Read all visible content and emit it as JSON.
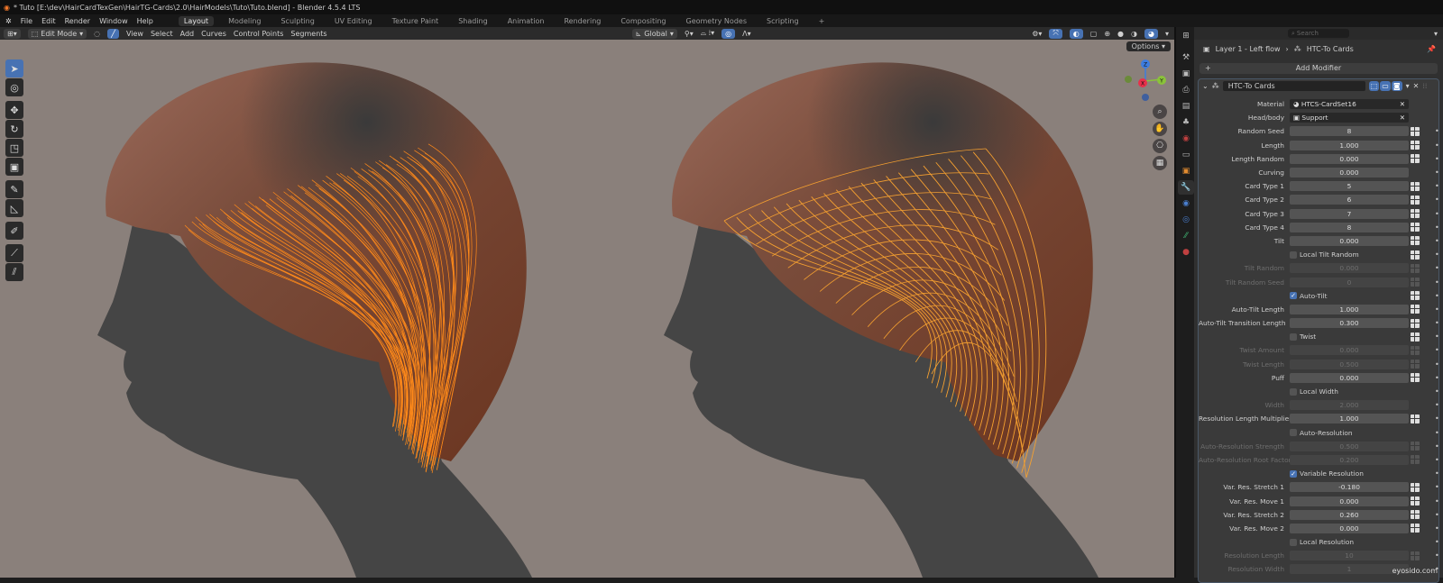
{
  "title": "* Tuto [E:\\dev\\HairCardTexGen\\HairTG-Cards\\2.0\\HairModels\\Tuto\\Tuto.blend] - Blender 4.5.4 LTS",
  "menu": [
    "File",
    "Edit",
    "Render",
    "Window",
    "Help"
  ],
  "workspaces": [
    "Layout",
    "Modeling",
    "Sculpting",
    "UV Editing",
    "Texture Paint",
    "Shading",
    "Animation",
    "Rendering",
    "Compositing",
    "Geometry Nodes",
    "Scripting",
    "+"
  ],
  "viewport_header": {
    "mode": "Edit Mode",
    "menus": [
      "View",
      "Select",
      "Add",
      "Curves",
      "Control Points",
      "Segments"
    ],
    "orientation": "Global",
    "options": "Options"
  },
  "gizmo": {
    "x": "X",
    "y": "Y",
    "z": "Z"
  },
  "props": {
    "search_placeholder": "Search",
    "breadcrumb": [
      "Layer 1 - Left flow",
      "HTC-To Cards"
    ],
    "add_modifier": "Add Modifier",
    "modifier_name": "HTC-To Cards",
    "rows": [
      {
        "label": "Material",
        "value": "HTCS-CardSet16",
        "type": "obj"
      },
      {
        "label": "Head/body",
        "value": "Support",
        "type": "obj"
      },
      {
        "label": "Random Seed",
        "value": "8",
        "deco": true
      },
      {
        "label": "Length",
        "value": "1.000",
        "deco": true
      },
      {
        "label": "Length Random",
        "value": "0.000",
        "deco": true
      },
      {
        "label": "Curving",
        "value": "0.000"
      },
      {
        "label": "Card Type 1",
        "value": "5",
        "deco": true
      },
      {
        "label": "Card Type 2",
        "value": "6",
        "deco": true
      },
      {
        "label": "Card Type 3",
        "value": "7",
        "deco": true
      },
      {
        "label": "Card Type 4",
        "value": "8",
        "deco": true
      },
      {
        "label": "Tilt",
        "value": "0.000",
        "deco": true
      },
      {
        "label": "Local Tilt Random",
        "type": "check",
        "checked": false,
        "deco": true
      },
      {
        "label": "Tilt Random",
        "value": "0.000",
        "disabled": true,
        "deco": true
      },
      {
        "label": "Tilt Random Seed",
        "value": "0",
        "disabled": true,
        "deco": true
      },
      {
        "label": "Auto-Tilt",
        "type": "check",
        "checked": true,
        "deco": true
      },
      {
        "label": "Auto-Tilt Length",
        "value": "1.000",
        "deco": true
      },
      {
        "label": "Auto-Tilt Transition Length",
        "value": "0.300",
        "deco": true
      },
      {
        "label": "Twist",
        "type": "check",
        "checked": false,
        "deco": true
      },
      {
        "label": "Twist Amount",
        "value": "0.000",
        "disabled": true,
        "deco": true
      },
      {
        "label": "Twist Length",
        "value": "0.500",
        "disabled": true,
        "deco": true
      },
      {
        "label": "Puff",
        "value": "0.000",
        "deco": true
      },
      {
        "label": "Local Width",
        "type": "check",
        "checked": false
      },
      {
        "label": "Width",
        "value": "2.000",
        "disabled": true
      },
      {
        "label": "Resolution Length Multiplier",
        "value": "1.000",
        "deco": true
      },
      {
        "label": "Auto-Resolution",
        "type": "check",
        "checked": false
      },
      {
        "label": "Auto-Resolution Strength",
        "value": "0.500",
        "disabled": true,
        "deco": true
      },
      {
        "label": "Auto-Resolution Root Factor",
        "value": "0.200",
        "disabled": true,
        "deco": true
      },
      {
        "label": "Variable Resolution",
        "type": "check",
        "checked": true
      },
      {
        "label": "Var. Res. Stretch 1",
        "value": "-0.180",
        "deco": true
      },
      {
        "label": "Var. Res. Move 1",
        "value": "0.000",
        "deco": true
      },
      {
        "label": "Var. Res. Stretch 2",
        "value": "0.260",
        "deco": true
      },
      {
        "label": "Var. Res. Move 2",
        "value": "0.000",
        "deco": true
      },
      {
        "label": "Local Resolution",
        "type": "check",
        "checked": false
      },
      {
        "label": "Resolution Length",
        "value": "10",
        "disabled": true,
        "deco": true
      },
      {
        "label": "Resolution Width",
        "value": "1",
        "disabled": true
      }
    ]
  },
  "watermark": "eyosido.com",
  "colors": {
    "accent": "#4772b3",
    "curve": "#ff8a1a",
    "background": "#8a807b",
    "head": "#454545"
  }
}
